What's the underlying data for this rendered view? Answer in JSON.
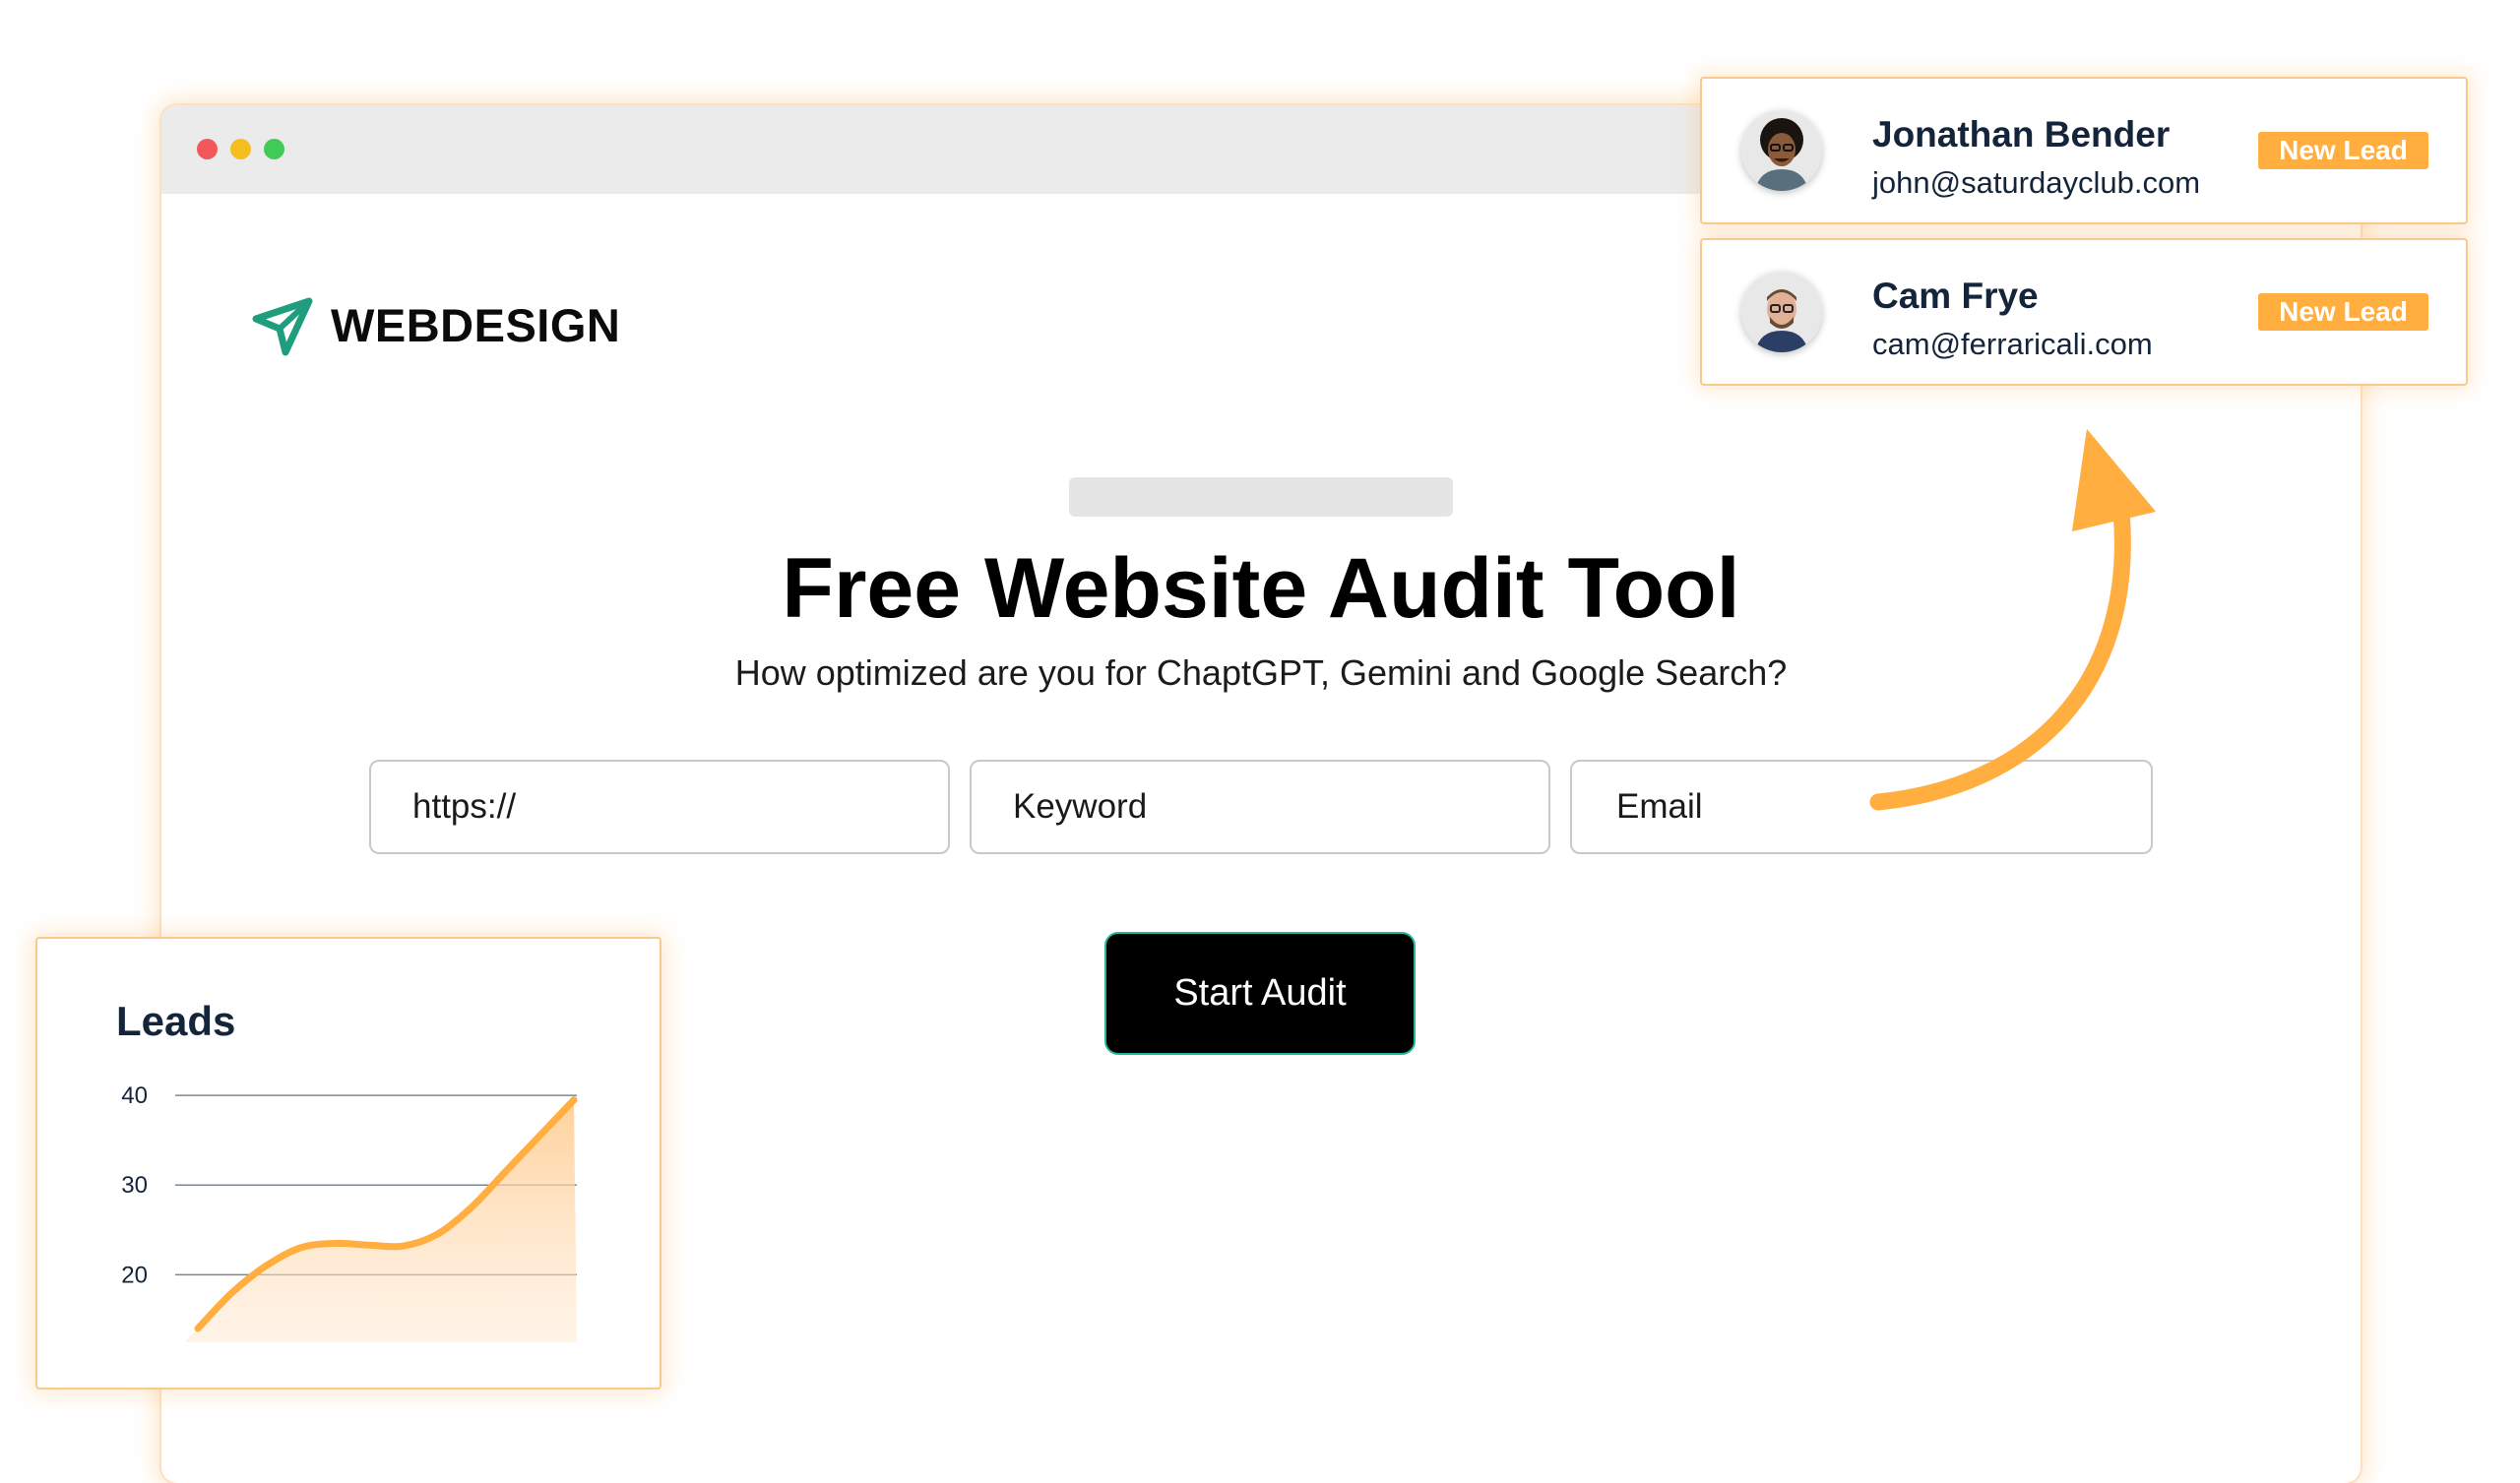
{
  "window": {
    "controls": [
      "close",
      "minimize",
      "maximize"
    ]
  },
  "brand": {
    "name": "WEBDESIGN",
    "icon": "paper-plane-icon",
    "icon_color": "#1f9e7f"
  },
  "hero": {
    "title": "Free Website Audit Tool",
    "subtitle": "How optimized are you for ChaptGPT, Gemini and Google Search?"
  },
  "form": {
    "url_placeholder": "https://",
    "keyword_placeholder": "Keyword",
    "email_placeholder": "Email",
    "submit_label": "Start Audit"
  },
  "leads": [
    {
      "name": "Jonathan Bender",
      "email": "john@saturdayclub.com",
      "badge": "New Lead",
      "avatar": "avatar-photo"
    },
    {
      "name": "Cam Frye",
      "email": "cam@ferraricali.com",
      "badge": "New Lead",
      "avatar": "avatar-photo"
    }
  ],
  "colors": {
    "accent": "#ffae3f",
    "badge": "#ffae3f",
    "text_dark": "#14243b",
    "button_bg": "#000000",
    "button_border": "#1fb89a"
  },
  "chart_card": {
    "title": "Leads"
  },
  "chart_data": {
    "type": "area",
    "title": "Leads",
    "xlabel": "",
    "ylabel": "",
    "ylim": [
      14,
      41
    ],
    "yticks": [
      40,
      30,
      20
    ],
    "grid": true,
    "series": [
      {
        "values": [
          14,
          18,
          21,
          23,
          23.5,
          23.3,
          23.2,
          24.5,
          27.5,
          31.5,
          35.5,
          39.5
        ]
      }
    ],
    "color": "#ffae3f"
  }
}
